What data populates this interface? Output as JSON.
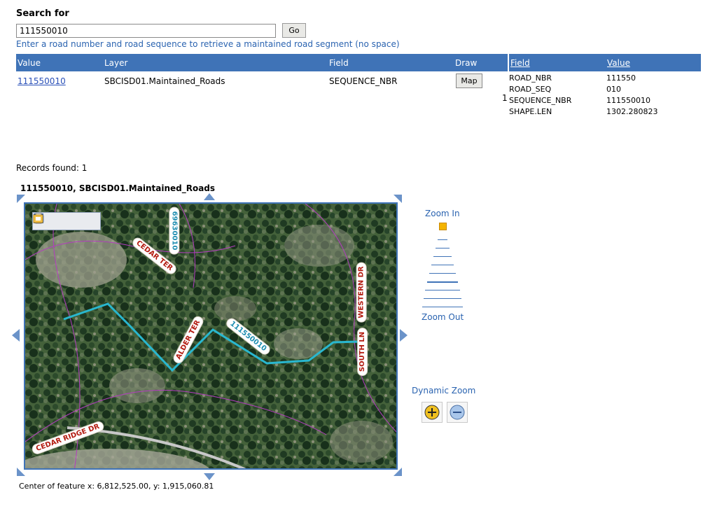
{
  "search": {
    "label": "Search for",
    "value": "111550010",
    "go_label": "Go",
    "hint": "Enter a road number and road sequence to retrieve a maintained road segment (no space)"
  },
  "results": {
    "headers": {
      "value": "Value",
      "layer": "Layer",
      "field": "Field",
      "draw": "Draw"
    },
    "rows": [
      {
        "value": "111550010",
        "layer": "SBCISD01.Maintained_Roads",
        "field": "SEQUENCE_NBR",
        "draw_label": "Map",
        "index": "1"
      }
    ]
  },
  "fields_table": {
    "headers": {
      "field": "Field",
      "value": "Value"
    },
    "rows": [
      {
        "field": "ROAD_NBR",
        "value": "111550"
      },
      {
        "field": "ROAD_SEQ",
        "value": "010"
      },
      {
        "field": "SEQUENCE_NBR",
        "value": "111550010"
      },
      {
        "field": "SHAPE.LEN",
        "value": "1302.280823"
      }
    ]
  },
  "records_found": "Records found: 1",
  "map": {
    "title": "111550010, SBCISD01.Maintained_Roads",
    "toolbar": [
      "save-icon",
      "print-icon",
      "email-icon",
      "export-icon"
    ],
    "labels": {
      "cedar_ter": "CEDAR TER",
      "road_number": "69630010",
      "western_dr": "WESTERN DR",
      "alder_ter": "ALDER TER",
      "segment_id": "111550010",
      "south_ln": "SOUTH LN",
      "cedar_ridge_dr": "CEDAR RIDGE DR"
    },
    "highlight_color": "#29b7cf",
    "road_color": "#b43cc0",
    "coords_text": "Center of feature x: 6,812,525.00, y: 1,915,060.81"
  },
  "zoom": {
    "in_label": "Zoom In",
    "out_label": "Zoom Out",
    "dynamic_label": "Dynamic Zoom",
    "current_level": 1,
    "total_levels": 9
  }
}
